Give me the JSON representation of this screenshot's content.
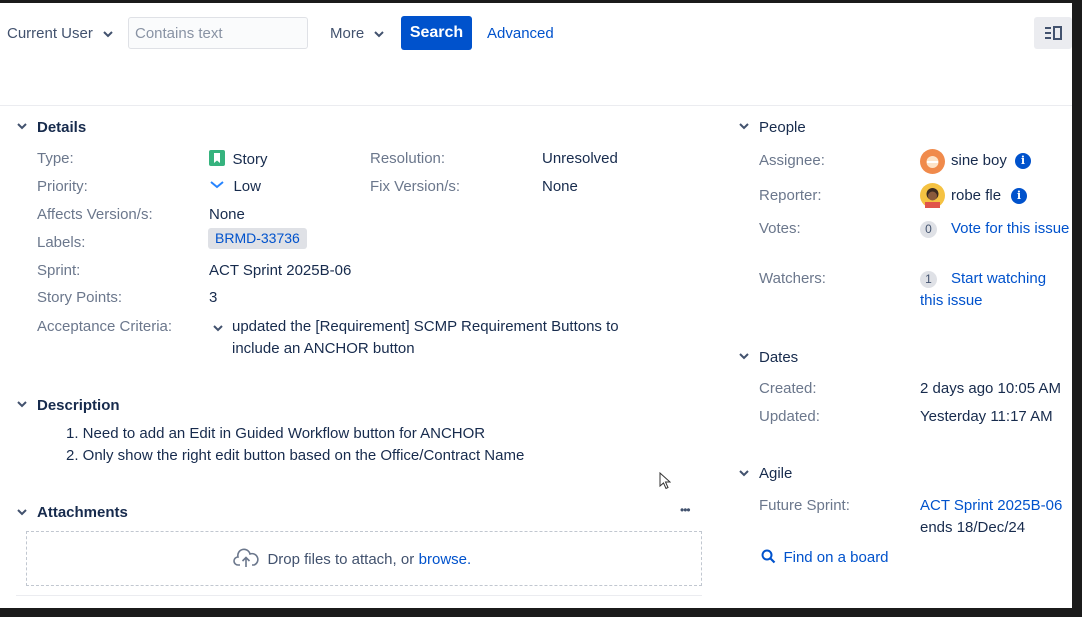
{
  "toolbar": {
    "user_filter": "Current User",
    "search_placeholder": "Contains text",
    "more_label": "More",
    "search_button": "Search",
    "advanced_link": "Advanced"
  },
  "details": {
    "header": "Details",
    "type_label": "Type:",
    "type_value": "Story",
    "priority_label": "Priority:",
    "priority_value": "Low",
    "affects_label": "Affects Version/s:",
    "affects_value": "None",
    "labels_label": "Labels:",
    "labels_value": "BRMD-33736",
    "sprint_label": "Sprint:",
    "sprint_value": "ACT Sprint 2025B-06",
    "points_label": "Story Points:",
    "points_value": "3",
    "criteria_label": "Acceptance Criteria:",
    "criteria_line1": "updated the [Requirement] SCMP Requirement Buttons to",
    "criteria_line2": "include an ANCHOR button",
    "resolution_label": "Resolution:",
    "resolution_value": "Unresolved",
    "fixversion_label": "Fix Version/s:",
    "fixversion_value": "None"
  },
  "description": {
    "header": "Description",
    "items": [
      "1. Need to add an Edit in Guided Workflow button for ANCHOR",
      "2. Only show the right edit button based on the Office/Contract Name"
    ]
  },
  "attachments": {
    "header": "Attachments",
    "more": "•••",
    "drop_text": "Drop files to attach, or",
    "browse_link": "browse."
  },
  "people": {
    "header": "People",
    "assignee_label": "Assignee:",
    "assignee_name": "sine boy",
    "reporter_label": "Reporter:",
    "reporter_name": "robe fle",
    "votes_label": "Votes:",
    "votes_count": "0",
    "votes_link": "Vote for this issue",
    "watchers_label": "Watchers:",
    "watchers_count": "1",
    "watchers_link_1": "Start watching",
    "watchers_link_2": "this issue"
  },
  "dates": {
    "header": "Dates",
    "created_label": "Created:",
    "created_value": "2 days ago 10:05 AM",
    "updated_label": "Updated:",
    "updated_value": "Yesterday 11:17 AM"
  },
  "agile": {
    "header": "Agile",
    "future_label": "Future Sprint:",
    "future_link": "ACT Sprint 2025B-06",
    "future_ends": "ends 18/Dec/24",
    "find_board": "Find on a board"
  },
  "colors": {
    "accent": "#0052cc",
    "story_icon": "#36b37e",
    "priority_low": "#2684ff"
  }
}
